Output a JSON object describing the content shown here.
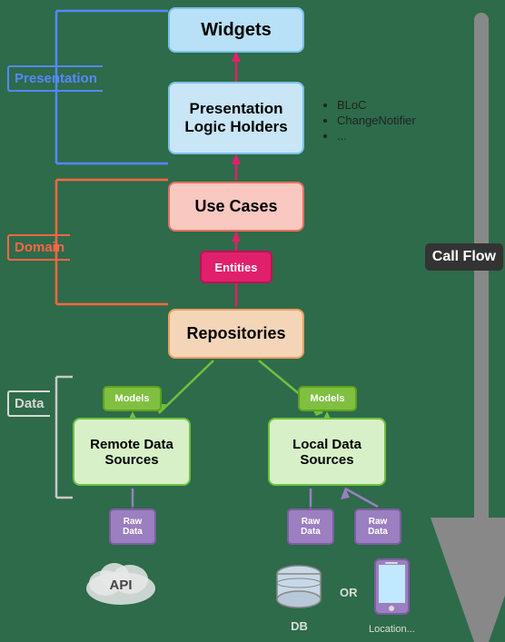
{
  "boxes": {
    "widgets": "Widgets",
    "plh": "Presentation Logic Holders",
    "usecases": "Use Cases",
    "entities": "Entities",
    "repos": "Repositories",
    "remote": "Remote Data Sources",
    "local": "Local Data Sources",
    "models_left": "Models",
    "models_right": "Models",
    "rawdata_left": "Raw Data",
    "rawdata_mid": "Raw Data",
    "rawdata_right": "Raw Data"
  },
  "labels": {
    "presentation": "Presentation",
    "domain": "Domain",
    "data": "Data",
    "callflow": "Call Flow"
  },
  "bloc_list": {
    "items": [
      "BLoC",
      "ChangeNotifier",
      "..."
    ]
  },
  "icons": {
    "api": "API",
    "db": "DB",
    "or": "OR",
    "location": "Location..."
  },
  "colors": {
    "widgets_bg": "#b8e0f7",
    "plh_bg": "#c8e6f5",
    "usecases_bg": "#f9c8c0",
    "entities_bg": "#e0206a",
    "repos_bg": "#f5d5b8",
    "data_bg": "#d8f0c8",
    "models_bg": "#80c040",
    "rawdata_bg": "#9b7fc0",
    "presentation_border": "#5588ff",
    "domain_border": "#ff6644",
    "data_border": "#d8d8d8",
    "arrow_pink": "#e0206a",
    "arrow_green": "#70c040",
    "arrow_gray": "#888888"
  }
}
